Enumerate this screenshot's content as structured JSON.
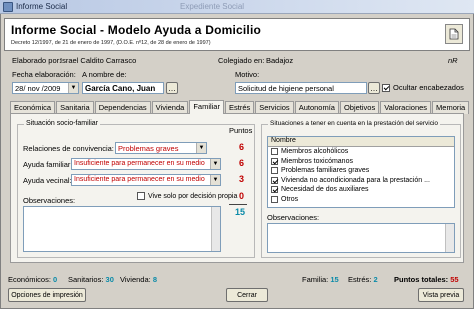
{
  "window": {
    "title": "Informe Social",
    "ghost_title": "Expediente Social"
  },
  "header": {
    "title": "Informe Social - Modelo Ayuda a Domicilio",
    "subtitle": "Decreto 12/1997, de 21 de enero de 1997, (D.O.E. nº12, de 28 de enero de 1997)",
    "print_icon": "document-icon"
  },
  "meta": {
    "elaborado_label": "Elaborado por:",
    "elaborado_value": "Israel Caldito Carrasco",
    "colegiado_label": "Colegiado en:",
    "colegiado_value": "Badajoz",
    "ref": "nR"
  },
  "form": {
    "fecha_label": "Fecha elaboración:",
    "fecha_value": "28/ nov /2009",
    "nombre_label": "A nombre de:",
    "nombre_value": "García Cano, Juan",
    "motivo_label": "Motivo:",
    "motivo_value": "Solicitud de higiene personal",
    "ocultar_label": "Ocultar encabezados",
    "ocultar_checked": true
  },
  "tabs": [
    {
      "label": "Económica",
      "active": false
    },
    {
      "label": "Sanitaria",
      "active": false
    },
    {
      "label": "Dependencias",
      "active": false
    },
    {
      "label": "Vivienda",
      "active": false
    },
    {
      "label": "Familiar",
      "active": true
    },
    {
      "label": "Estrés",
      "active": false
    },
    {
      "label": "Servicios",
      "active": false
    },
    {
      "label": "Autonomía",
      "active": false
    },
    {
      "label": "Objetivos",
      "active": false
    },
    {
      "label": "Valoraciones",
      "active": false
    },
    {
      "label": "Memoria",
      "active": false
    }
  ],
  "familiar": {
    "group_title": "Situación socio-familiar",
    "puntos_label": "Puntos",
    "rows": [
      {
        "label": "Relaciones de convivencia:",
        "value": "Problemas graves",
        "points": "6"
      },
      {
        "label": "Ayuda familiar:",
        "value": "Insuficiente para permanecer en su medio",
        "points": "6"
      },
      {
        "label": "Ayuda vecinal:",
        "value": "Insuficiente para permanecer en su medio",
        "points": "3"
      }
    ],
    "vive_solo_label": "Vive solo por decisión propia",
    "vive_solo_points": "0",
    "observaciones_label": "Observaciones:",
    "total_points": "15"
  },
  "riesgo": {
    "group_title": "Situaciones a tener en cuenta en la prestación del servicio",
    "column": "Nombre",
    "items": [
      {
        "label": "Miembros alcohólicos",
        "checked": false
      },
      {
        "label": "Miembros toxicómanos",
        "checked": true
      },
      {
        "label": "Problemas familiares graves",
        "checked": false
      },
      {
        "label": "Vivienda no acondicionada para la prestación ...",
        "checked": true
      },
      {
        "label": "Necesidad de dos auxiliares",
        "checked": true
      },
      {
        "label": "Otros",
        "checked": false
      }
    ],
    "observaciones_label": "Observaciones:"
  },
  "status": {
    "economicos_label": "Económicos:",
    "economicos": "0",
    "sanitarios_label": "Sanitarios:",
    "sanitarios": "30",
    "vivienda_label": "Vivienda:",
    "vivienda": "8",
    "familia_label": "Familia:",
    "familia": "15",
    "estres_label": "Estrés:",
    "estres": "2",
    "total_label": "Puntos totales:",
    "total": "55"
  },
  "buttons": {
    "print_options": "Opciones de impresión",
    "close": "Cerrar",
    "preview": "Vista previa"
  },
  "colors": {
    "score_red": "#c00000",
    "score_blue": "#0a8aa8"
  }
}
